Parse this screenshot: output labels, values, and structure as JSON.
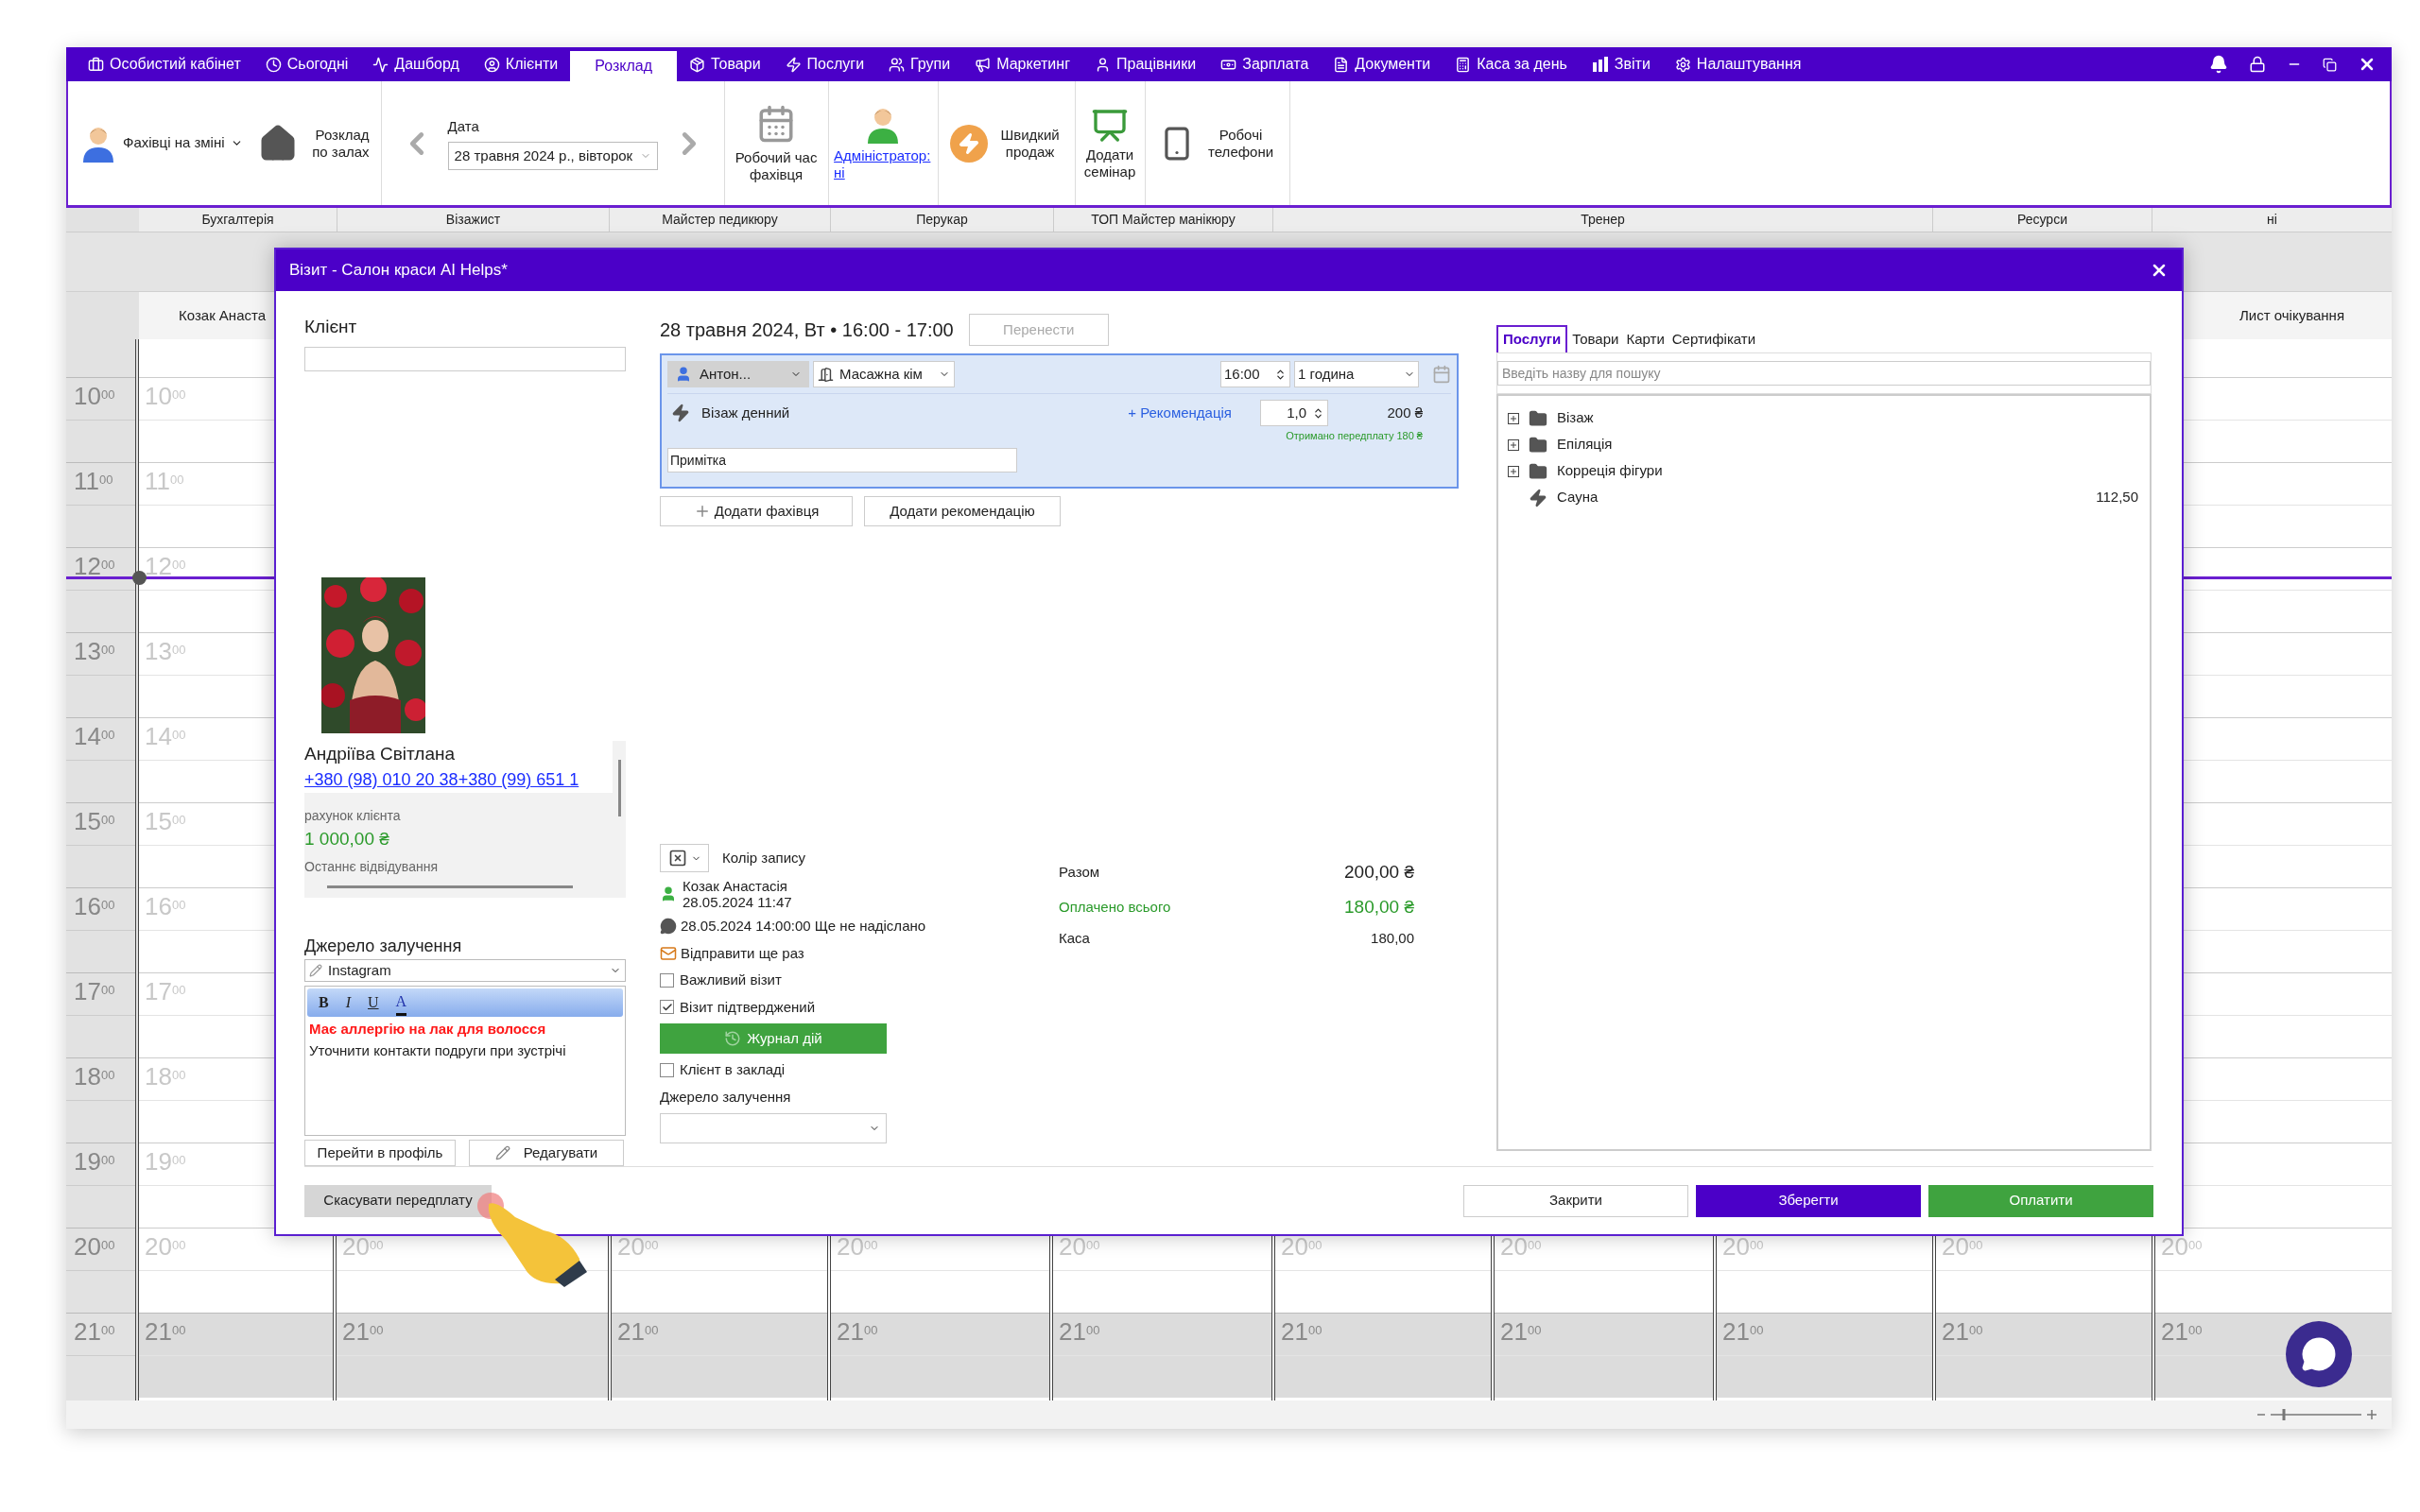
{
  "menu": {
    "tabs": [
      {
        "label": "Особистий кабінет",
        "selected": false
      },
      {
        "label": "Сьогодні",
        "selected": false
      },
      {
        "label": "Дашборд",
        "selected": false
      },
      {
        "label": "Клієнти",
        "selected": false
      },
      {
        "label": "Розклад",
        "selected": true
      },
      {
        "label": "Товари",
        "selected": false
      },
      {
        "label": "Послуги",
        "selected": false
      },
      {
        "label": "Групи",
        "selected": false
      },
      {
        "label": "Маркетинг",
        "selected": false
      },
      {
        "label": "Працівники",
        "selected": false
      },
      {
        "label": "Зарплата",
        "selected": false
      },
      {
        "label": "Документи",
        "selected": false
      },
      {
        "label": "Каса за день",
        "selected": false
      },
      {
        "label": "Звіти",
        "selected": false
      },
      {
        "label": "Налаштування",
        "selected": false
      }
    ]
  },
  "toolbar": {
    "staff_on_shift": "Фахівці на зміні",
    "halls_schedule": "Розклад по залах",
    "date_label": "Дата",
    "date_value": "28 травня 2024 р., вівторок",
    "work_time": "Робочий час фахівця",
    "admin_link": "Адміністратор: ні",
    "quick_sale": "Швидкий продаж",
    "add_seminar": "Додати семінар",
    "work_phones": "Робочі телефони"
  },
  "calendar": {
    "headers": [
      "Бухгалтерія",
      "Візажист",
      "Майстер педикюру",
      "Перукар",
      "ТОП Майстер манікюру",
      "Тренер",
      "Ресурси",
      "ні"
    ],
    "staff_name": "Козак Анаста",
    "waiting_list": "Лист очікування",
    "time_labels": [
      "10$^{00}$",
      "11$^{00}$",
      "12$^{00}$",
      "13$^{00}$",
      "14$^{00}$",
      "15$^{00}$",
      "16$^{00}$",
      "17$^{00}$",
      "18$^{00}$",
      "19$^{00}$",
      "20$^{00}$",
      "21$^{00}$"
    ],
    "columns": [
      {
        "labels": [
          "10$^{00}$",
          "11$^{00}$",
          "12$^{00}$",
          "13$^{00}$",
          "14$^{00}$",
          "15$^{00}$",
          "16$^{00}$",
          "17$^{00}$",
          "18$^{00}$",
          "19$^{00}$",
          "20$^{00}$",
          "21$^{00}$"
        ]
      },
      {
        "labels": [
          "20$^{00}$",
          "21$^{00}$"
        ]
      },
      {
        "labels": [
          "20$^{00}$",
          "21$^{00}$"
        ]
      },
      {
        "labels": [
          "20$^{00}$",
          "21$^{00}$"
        ]
      },
      {
        "labels": [
          "20$^{00}$",
          "21$^{00}$"
        ]
      },
      {
        "labels": [
          "20$^{00}$",
          "21$^{00}$"
        ]
      },
      {
        "labels": [
          "20$^{00}$",
          "21$^{00}$"
        ]
      },
      {
        "labels": [
          "20$^{00}$",
          "21$^{00}$"
        ]
      },
      {
        "labels": [
          "20$^{00}$",
          "21$^{00}$"
        ]
      },
      {
        "labels": [
          "20$^{00}$",
          "21$^{00}$"
        ]
      }
    ]
  },
  "dialog": {
    "title": "Візит - Салон краси AI Helps*",
    "client": {
      "label": "Клієнт",
      "name": "Андріїва Світлана",
      "phone": "+380 (98) 010 20 38+380 (99) 651 1",
      "account_label": "рахунок клієнта",
      "balance": "1 000,00 ₴",
      "last_visit_label": "Останнє відвідування",
      "source_label": "Джерело залучення",
      "source_value": "Instagram",
      "notes": [
        {
          "text": "Має аллергію на лак для волосся",
          "important": true
        },
        {
          "text": "Уточнити контакти подруги при зустрічі",
          "important": false
        }
      ],
      "editor_buttons": [
        "B",
        "I",
        "U",
        "A"
      ],
      "profile_button": "Перейти в профіль",
      "edit_button": "Редагувати",
      "cancel_prepayment": "Скасувати передплату"
    },
    "visit": {
      "datetime": "28 травня 2024, Вт • 16:00 - 17:00",
      "move_button": {
        "label": "Перенести",
        "disabled": true
      },
      "specialist": "Антон...",
      "room": "Масажна кім",
      "start_time": "16:00",
      "duration": "1 година",
      "service": "Візаж денний",
      "recommendation_link": "+ Рекомендація",
      "quantity": "1,0",
      "price": "200 ₴",
      "prepayment_note": "Отримано передплату 180 ₴",
      "note_placeholder": "Примітка",
      "add_specialist": "Додати фахівця",
      "add_recommendation": "Додати рекомендацію",
      "color_label": "Колір запису",
      "created_by": "Козак Анастасія",
      "created_at": "28.05.2024 11:47",
      "reminder": "28.05.2024 14:00:00 Ще не надіслано",
      "resend": "Відправити ще раз",
      "options": [
        {
          "kind": "checkbox",
          "label": "Важливий візит",
          "checked": false
        },
        {
          "kind": "checkbox",
          "label": "Візит підтверджений",
          "checked": true
        },
        {
          "kind": "button",
          "label": "Журнал дій"
        },
        {
          "kind": "checkbox",
          "label": "Клієнт в закладі",
          "checked": false
        }
      ],
      "source_label": "Джерело залучення",
      "totals": [
        {
          "kind": "total",
          "label": "Разом",
          "value": "200,00 ₴"
        },
        {
          "kind": "paid",
          "label": "Оплачено всього",
          "value": "180,00 ₴"
        },
        {
          "kind": "cash",
          "label": "Каса",
          "value": "180,00"
        }
      ]
    },
    "catalog": {
      "tabs": [
        {
          "label": "Послуги",
          "selected": true
        },
        {
          "label": "Товари",
          "selected": false
        },
        {
          "label": "Карти",
          "selected": false
        },
        {
          "label": "Сертифікати",
          "selected": false
        }
      ],
      "search_placeholder": "Введіть назву для пошуку",
      "items": [
        {
          "kind": "folder",
          "label": "Візаж",
          "expanded": false
        },
        {
          "kind": "folder",
          "label": "Епіляція",
          "expanded": false
        },
        {
          "kind": "folder",
          "label": "Корреція фігури",
          "expanded": false
        },
        {
          "kind": "service",
          "label": "Сауна",
          "price": "112,50"
        }
      ]
    },
    "footer_buttons": [
      {
        "kind": "secondary",
        "label": "Закрити"
      },
      {
        "kind": "primary",
        "label": "Зберегти"
      },
      {
        "kind": "pay",
        "label": "Оплатити"
      }
    ]
  }
}
